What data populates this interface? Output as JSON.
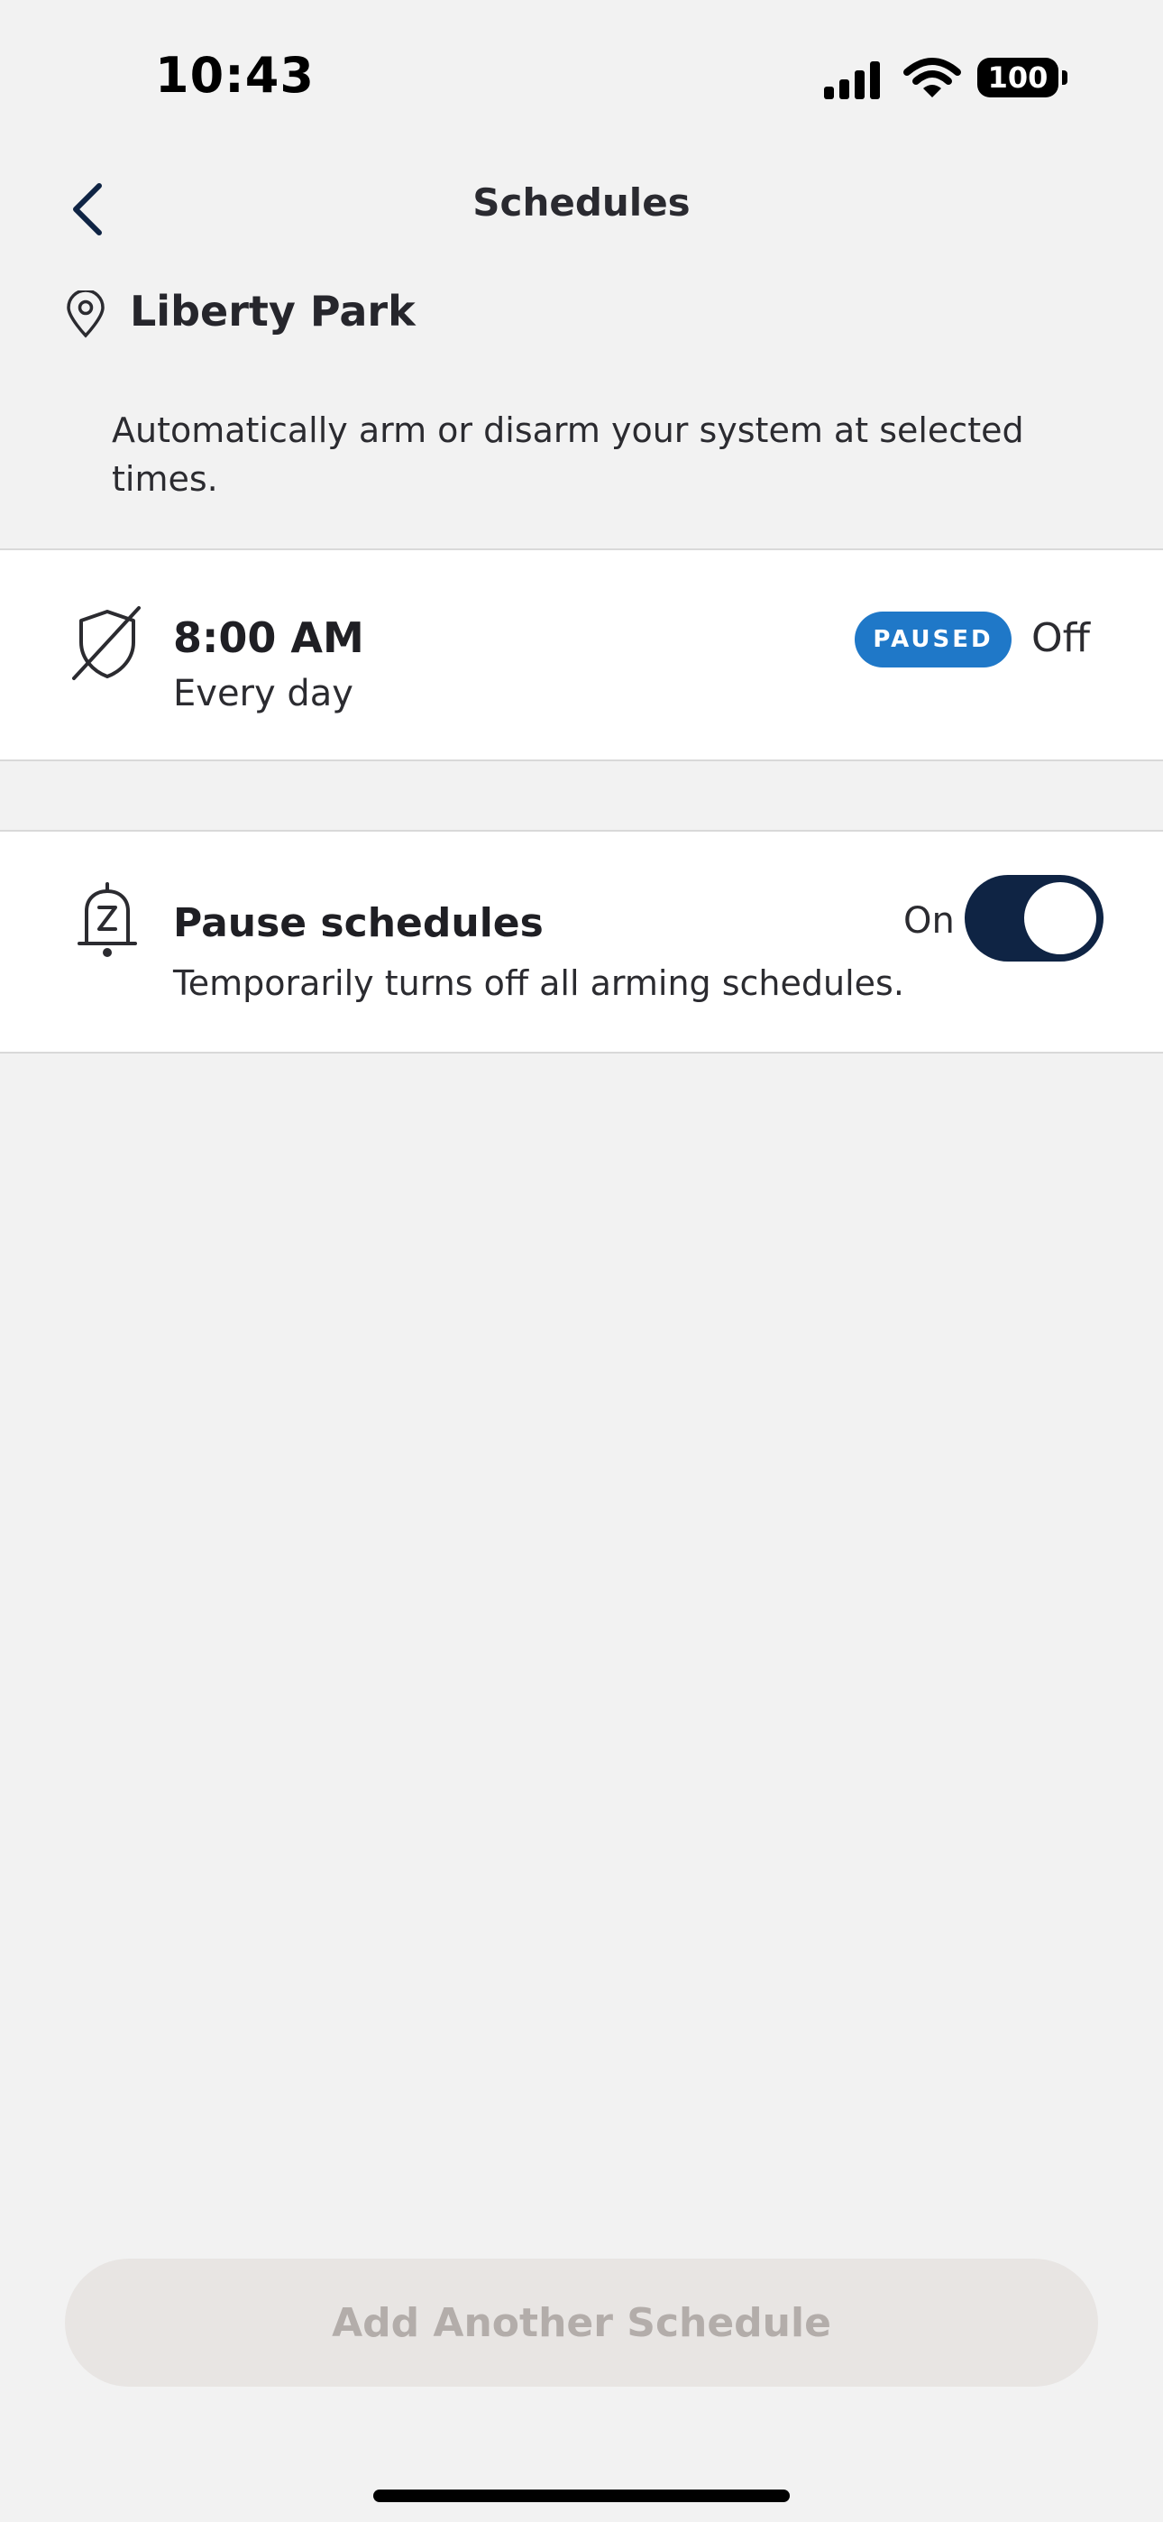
{
  "status_bar": {
    "time": "10:43",
    "battery": "100",
    "icons": [
      "signal-icon",
      "wifi-icon",
      "battery-icon"
    ]
  },
  "nav": {
    "title": "Schedules",
    "back_icon": "chevron-left-icon"
  },
  "location": {
    "icon": "location-pin-icon",
    "name": "Liberty Park"
  },
  "description": "Automatically arm or disarm your system at selected times.",
  "schedules": [
    {
      "icon": "shield-off-icon",
      "time": "8:00 AM",
      "repeat": "Every day",
      "badge": "PAUSED",
      "state": "Off"
    }
  ],
  "pause_schedules": {
    "icon": "bell-snooze-icon",
    "title": "Pause schedules",
    "subtitle": "Temporarily turns off all arming schedules.",
    "toggle_label": "On",
    "toggle_on": true
  },
  "add_button": "Add Another Schedule",
  "colors": {
    "background": "#f2f2f2",
    "card": "#ffffff",
    "badge_blue": "#1f78c8",
    "toggle_navy": "#0f2444",
    "button_disabled_bg": "#e8e5e3",
    "button_disabled_text": "#b3adaa"
  }
}
